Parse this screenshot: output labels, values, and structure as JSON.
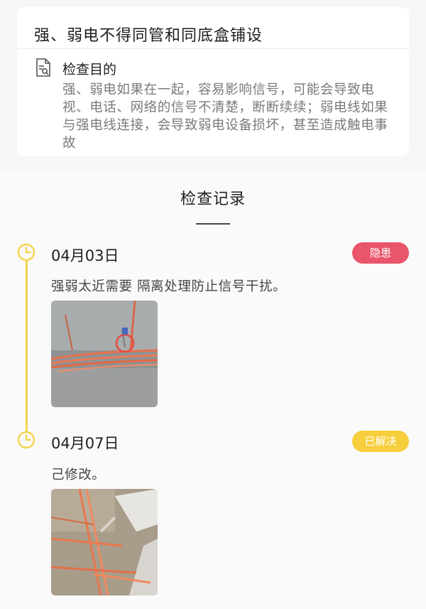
{
  "item": {
    "title": "强、弱电不得同管和同底盒铺设",
    "purpose_heading": "检查目的",
    "purpose_text": "强、弱电如果在一起，容易影响信号，可能会导致电视、电话、网络的信号不清楚，断断续续；弱电线如果与强电线连接，会导致弱电设备损坏，甚至造成触电事故"
  },
  "records": {
    "title": "检查记录",
    "entries": [
      {
        "date": "04月03日",
        "status": "隐患",
        "status_color": "#e9556a",
        "note": "强弱太近需要 隔离处理防止信号干扰。",
        "photo_icon": "construction-wiring-photo"
      },
      {
        "date": "04月07日",
        "status": "已解决",
        "status_color": "#f7cf3d",
        "note": "己修改。",
        "photo_icon": "construction-wiring-photo"
      }
    ]
  },
  "colors": {
    "timeline": "#f5d44e",
    "danger": "#e9556a",
    "resolved": "#f7cf3d"
  }
}
